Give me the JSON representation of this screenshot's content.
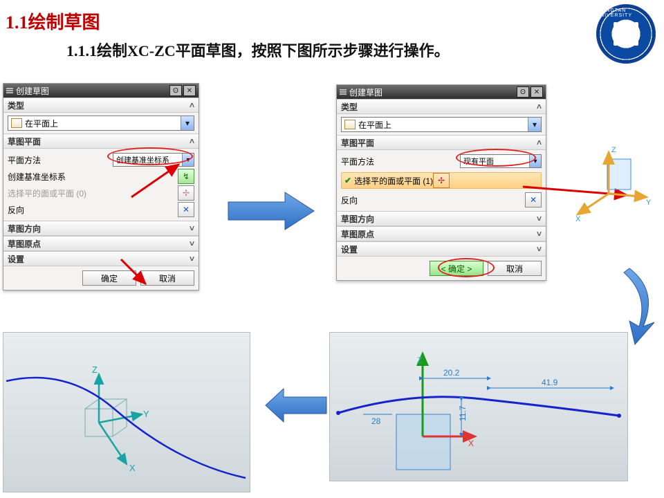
{
  "heading": "1.1绘制草图",
  "subheading": "1.1.1绘制XC-ZC平面草图，按照下图所示步骤进行操作。",
  "logo_text": "XIANGTAN UNIVERSITY",
  "dialog": {
    "title": "创建草图",
    "sections": {
      "type": "类型",
      "plane": "草图平面",
      "dir": "草图方向",
      "origin": "草图原点",
      "settings": "设置"
    },
    "type_option": "在平面上",
    "left": {
      "plane_method_label": "平面方法",
      "plane_method_value": "创建基准坐标系",
      "csys_label": "创建基准坐标系",
      "select_face_label": "选择平的面或平面 (0)",
      "reverse_label": "反向"
    },
    "right": {
      "plane_method_label": "平面方法",
      "plane_method_value": "现有平面",
      "select_face_label": "选择平的面或平面 (1)",
      "reverse_label": "反向"
    },
    "ok": "< 确定 >",
    "ok_plain": "确定",
    "cancel": "取消"
  },
  "dims": {
    "a": "20.2",
    "b": "41.9",
    "c": "28",
    "d": "11.7"
  },
  "axes": {
    "x": "X",
    "y": "Y",
    "z": "Z"
  }
}
